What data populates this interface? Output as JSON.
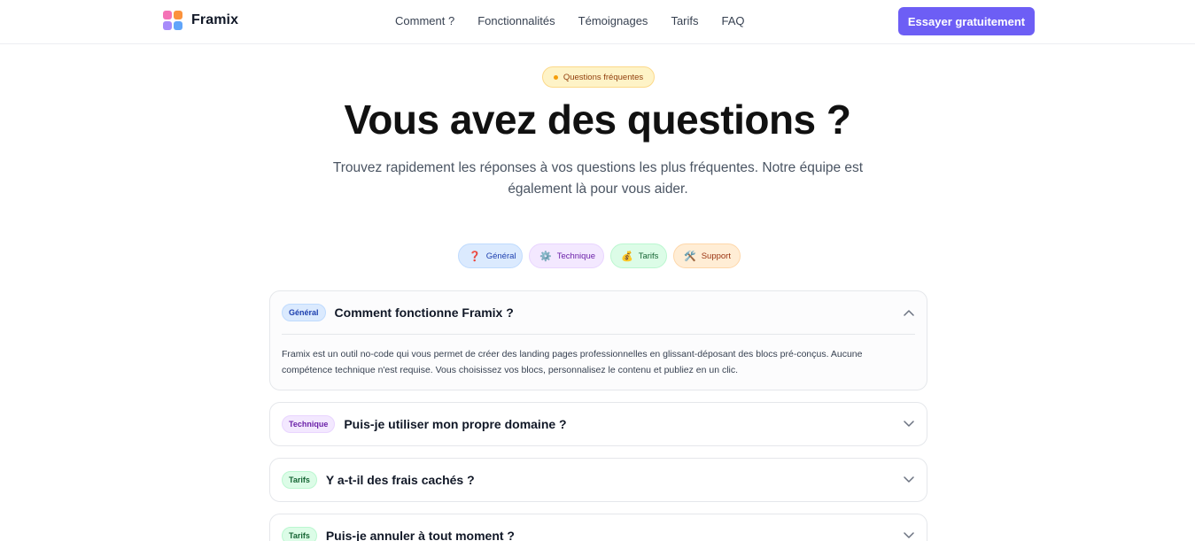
{
  "brand": {
    "name": "Framix"
  },
  "nav": {
    "items": [
      "Comment ?",
      "Fonctionnalités",
      "Témoignages",
      "Tarifs",
      "FAQ"
    ],
    "cta": "Essayer gratuitement"
  },
  "hero": {
    "badge": "Questions fréquentes",
    "title": "Vous avez des questions ?",
    "subtitle": "Trouvez rapidement les réponses à vos questions les plus fréquentes. Notre équipe est également là pour vous aider."
  },
  "filters": [
    {
      "icon": "❓",
      "label": "Général"
    },
    {
      "icon": "⚙️",
      "label": "Technique"
    },
    {
      "icon": "💰",
      "label": "Tarifs"
    },
    {
      "icon": "🛠️",
      "label": "Support"
    }
  ],
  "faq": [
    {
      "tag": "Général",
      "question": "Comment fonctionne Framix ?",
      "expanded": true,
      "answer": "Framix est un outil no-code qui vous permet de créer des landing pages professionnelles en glissant-déposant des blocs pré-conçus. Aucune compétence technique n'est requise. Vous choisissez vos blocs, personnalisez le contenu et publiez en un clic."
    },
    {
      "tag": "Technique",
      "question": "Puis-je utiliser mon propre domaine ?",
      "expanded": false
    },
    {
      "tag": "Tarifs",
      "question": "Y a-t-il des frais cachés ?",
      "expanded": false
    },
    {
      "tag": "Tarifs",
      "question": "Puis-je annuler à tout moment ?",
      "expanded": false
    }
  ],
  "colors": {
    "accent": "#6d5ef5",
    "general": "#1e40af",
    "technique": "#6b21a8",
    "tarifs": "#166534",
    "support": "#9a3412"
  }
}
